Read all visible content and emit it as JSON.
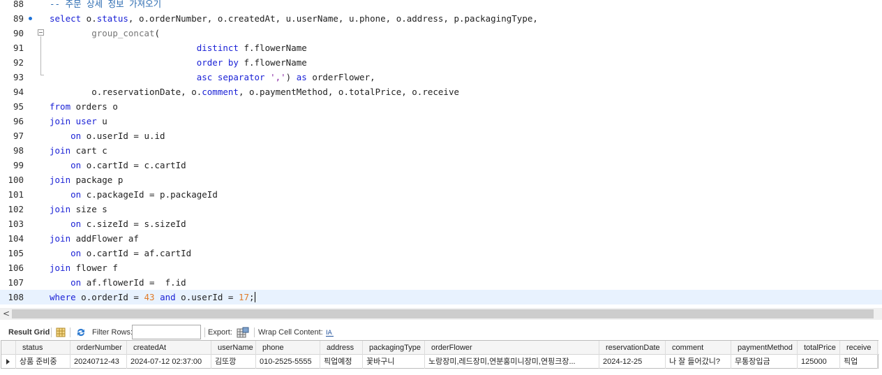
{
  "editor": {
    "lines": [
      {
        "n": "88",
        "tokens": [
          [
            "cm",
            "-- 주문 상세 정보 가져오기"
          ]
        ]
      },
      {
        "n": "89",
        "marker": true,
        "tokens": [
          [
            "kw",
            "select"
          ],
          [
            "",
            " o."
          ],
          [
            "kw",
            "status"
          ],
          [
            "",
            ", o.orderNumber, o.createdAt, u.userName, u.phone, o.address, p.packagingType,"
          ]
        ]
      },
      {
        "n": "90",
        "tokens": [
          [
            "",
            "        "
          ],
          [
            "fn",
            "group_concat"
          ],
          [
            "",
            "("
          ]
        ]
      },
      {
        "n": "91",
        "tokens": [
          [
            "",
            "                            "
          ],
          [
            "kw",
            "distinct"
          ],
          [
            "",
            " f.flowerName"
          ]
        ]
      },
      {
        "n": "92",
        "tokens": [
          [
            "",
            "                            "
          ],
          [
            "kw",
            "order by"
          ],
          [
            "",
            " f.flowerName"
          ]
        ]
      },
      {
        "n": "93",
        "tokens": [
          [
            "",
            "                            "
          ],
          [
            "kw",
            "asc separator"
          ],
          [
            "",
            " "
          ],
          [
            "str",
            "','"
          ],
          [
            "",
            ") "
          ],
          [
            "kw",
            "as"
          ],
          [
            "",
            " orderFlower,"
          ]
        ]
      },
      {
        "n": "94",
        "tokens": [
          [
            "",
            "        o.reservationDate, o."
          ],
          [
            "kw",
            "comment"
          ],
          [
            "",
            ", o.paymentMethod, o.totalPrice, o.receive"
          ]
        ]
      },
      {
        "n": "95",
        "tokens": [
          [
            "kw",
            "from"
          ],
          [
            "",
            " orders o"
          ]
        ]
      },
      {
        "n": "96",
        "tokens": [
          [
            "kw",
            "join"
          ],
          [
            "",
            " "
          ],
          [
            "kw",
            "user"
          ],
          [
            "",
            " u"
          ]
        ]
      },
      {
        "n": "97",
        "tokens": [
          [
            "",
            "    "
          ],
          [
            "kw",
            "on"
          ],
          [
            "",
            " o.userId = u.id"
          ]
        ]
      },
      {
        "n": "98",
        "tokens": [
          [
            "kw",
            "join"
          ],
          [
            "",
            " cart c"
          ]
        ]
      },
      {
        "n": "99",
        "tokens": [
          [
            "",
            "    "
          ],
          [
            "kw",
            "on"
          ],
          [
            "",
            " o.cartId = c.cartId"
          ]
        ]
      },
      {
        "n": "100",
        "tokens": [
          [
            "kw",
            "join"
          ],
          [
            "",
            " package p"
          ]
        ]
      },
      {
        "n": "101",
        "tokens": [
          [
            "",
            "    "
          ],
          [
            "kw",
            "on"
          ],
          [
            "",
            " c.packageId = p.packageId"
          ]
        ]
      },
      {
        "n": "102",
        "tokens": [
          [
            "kw",
            "join"
          ],
          [
            "",
            " size s"
          ]
        ]
      },
      {
        "n": "103",
        "tokens": [
          [
            "",
            "    "
          ],
          [
            "kw",
            "on"
          ],
          [
            "",
            " c.sizeId = s.sizeId"
          ]
        ]
      },
      {
        "n": "104",
        "tokens": [
          [
            "kw",
            "join"
          ],
          [
            "",
            " addFlower af"
          ]
        ]
      },
      {
        "n": "105",
        "tokens": [
          [
            "",
            "    "
          ],
          [
            "kw",
            "on"
          ],
          [
            "",
            " o.cartId = af.cartId"
          ]
        ]
      },
      {
        "n": "106",
        "tokens": [
          [
            "kw",
            "join"
          ],
          [
            "",
            " flower f"
          ]
        ]
      },
      {
        "n": "107",
        "tokens": [
          [
            "",
            "    "
          ],
          [
            "kw",
            "on"
          ],
          [
            "",
            " af.flowerId =  f.id"
          ]
        ]
      },
      {
        "n": "108",
        "current": true,
        "tokens": [
          [
            "kw",
            "where"
          ],
          [
            "",
            " o.orderId = "
          ],
          [
            "num",
            "43"
          ],
          [
            "",
            " "
          ],
          [
            "kw",
            "and"
          ],
          [
            "",
            " o.userId = "
          ],
          [
            "num",
            "17"
          ],
          [
            "",
            ";"
          ]
        ]
      }
    ]
  },
  "scrollbar": {
    "left_arrow": "<"
  },
  "result_toolbar": {
    "title": "Result Grid",
    "filter_label": "Filter Rows:",
    "filter_value": "",
    "export_label": "Export:",
    "wrap_label": "Wrap Cell Content:",
    "icons": [
      "grid-icon",
      "refresh-icon",
      "export-icon",
      "wrap-icon"
    ]
  },
  "grid": {
    "columns": [
      "status",
      "orderNumber",
      "createdAt",
      "userName",
      "phone",
      "address",
      "packagingType",
      "orderFlower",
      "reservationDate",
      "comment",
      "paymentMethod",
      "totalPrice",
      "receive"
    ],
    "rows": [
      [
        "상품 준비중",
        "20240712-43",
        "2024-07-12 02:37:00",
        "김또깡",
        "010-2525-5555",
        "픽업예정",
        "꽃바구니",
        "노랑장미,레드장미,연분홍미니장미,연핑크장...",
        "2024-12-25",
        "나 잘 들어갔니?",
        "무통장입금",
        "125000",
        "픽업"
      ]
    ]
  },
  "colors": {
    "keyword": "#1b22d6",
    "comment": "#2a6ab0",
    "string": "#8b2aa6",
    "number": "#e07b2a",
    "current_line": "#e8f2fe",
    "marker": "#1e72d8"
  }
}
